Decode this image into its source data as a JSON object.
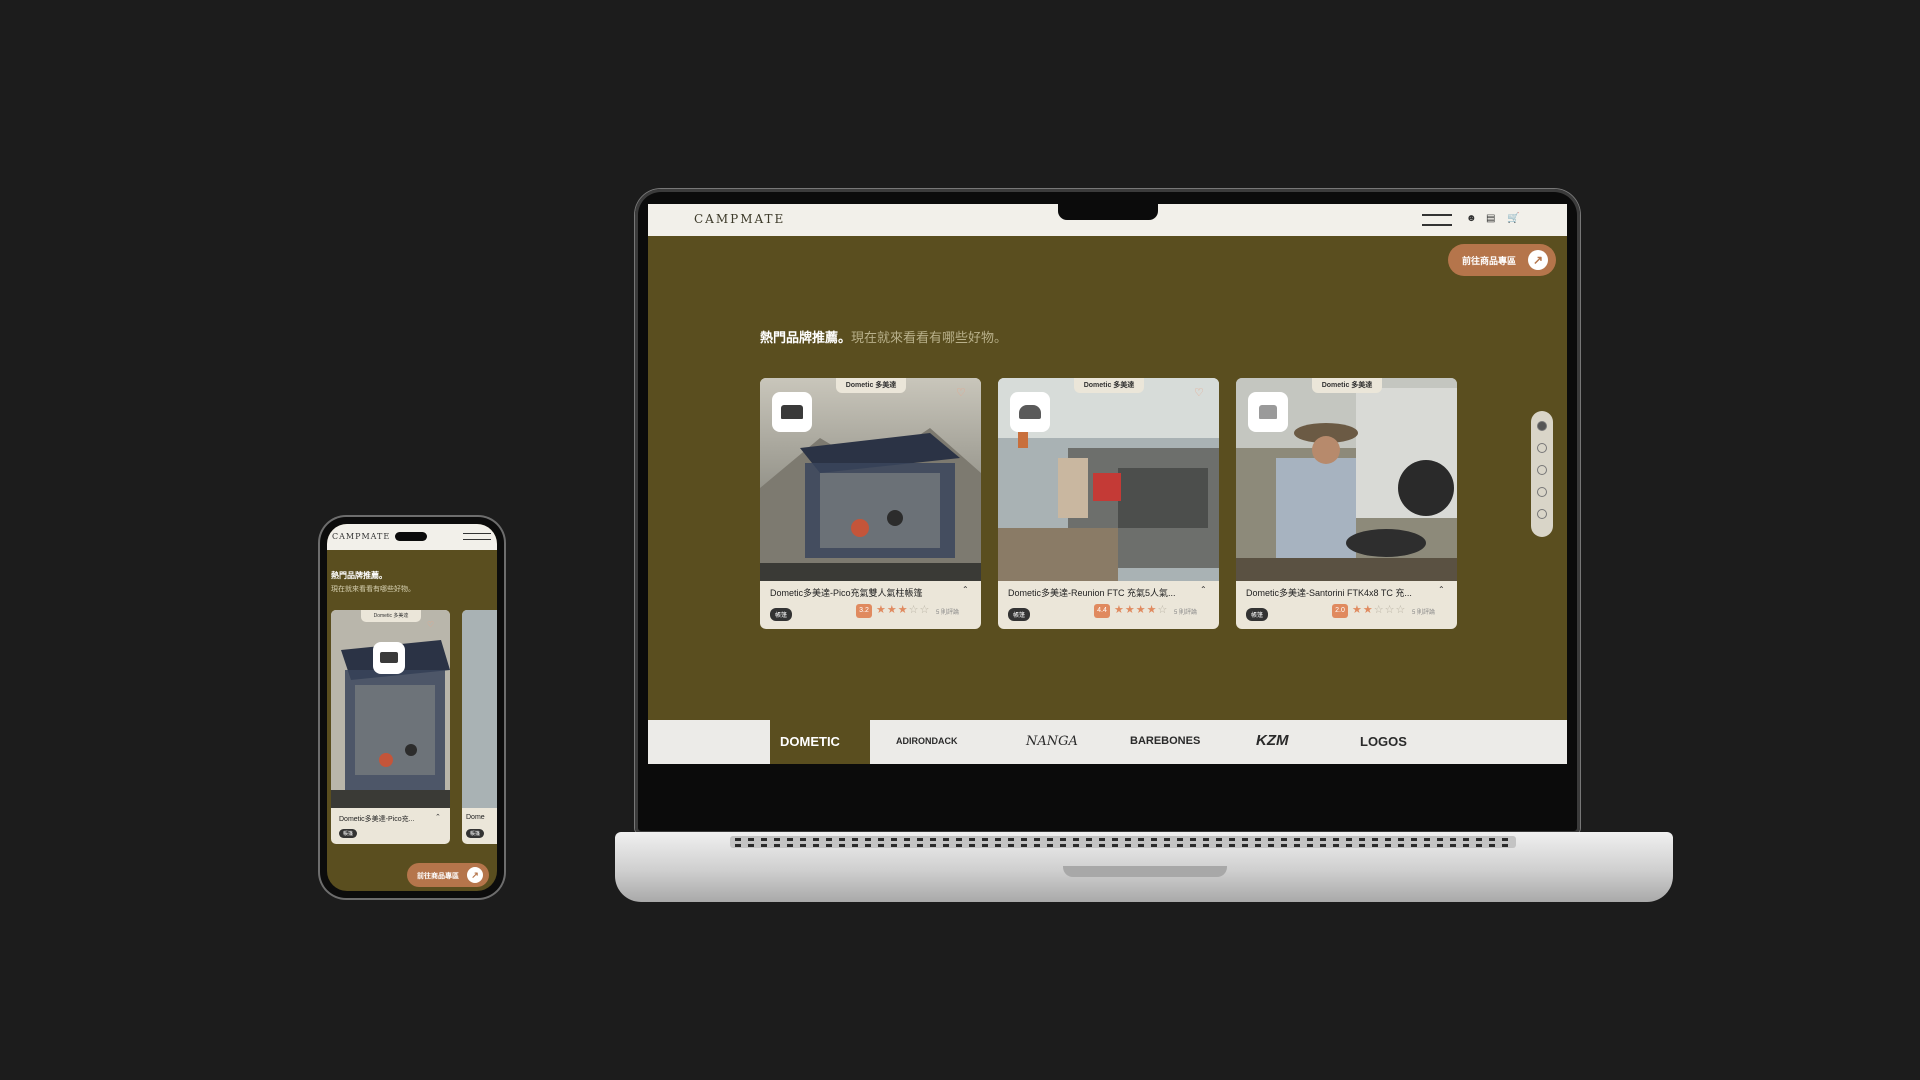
{
  "site": {
    "logo": "CAMPMATE"
  },
  "nav": {
    "icons": [
      "menu-icon",
      "user-icon",
      "message-icon",
      "cart-icon"
    ]
  },
  "cta": {
    "label": "前往商品專區"
  },
  "section": {
    "title": "熱門品牌推薦。",
    "subtitle": "現在就來看看有哪些好物。"
  },
  "products": [
    {
      "brand_tag": "Dometic 多美達",
      "title": "Dometic多美達-Pico充氣雙人氣柱帳篷",
      "badge": "帳篷",
      "score": "3.2",
      "stars": 3,
      "reviews": "5 則評論"
    },
    {
      "brand_tag": "Dometic 多美達",
      "title": "Dometic多美達-Reunion FTC 充氣5人氣...",
      "badge": "帳篷",
      "score": "4.4",
      "stars": 4,
      "reviews": "5 則評論"
    },
    {
      "brand_tag": "Dometic 多美達",
      "title": "Dometic多美達-Santorini FTK4x8 TC 充...",
      "badge": "帳篷",
      "score": "2.0",
      "stars": 2,
      "reviews": "5 則評論"
    }
  ],
  "brands": [
    "DOMETIC",
    "ADIRONDACK",
    "NANGA",
    "BAREBONES",
    "KZM",
    "LOGOS"
  ],
  "mobile": {
    "logo": "CAMPMATE",
    "title": "熱門品牌推薦。",
    "subtitle": "現在就來看看有哪些好物。",
    "card_brand_tag": "Dometic 多美達",
    "card_title": "Dometic多美達-Pico充...",
    "card_badge": "帳篷",
    "peek_title": "Dome",
    "cta": "前往商品專區"
  },
  "colors": {
    "olive": "#5a4e1f",
    "accent": "#b5754b",
    "star": "#e08a5f",
    "card": "#ebe6d9"
  }
}
